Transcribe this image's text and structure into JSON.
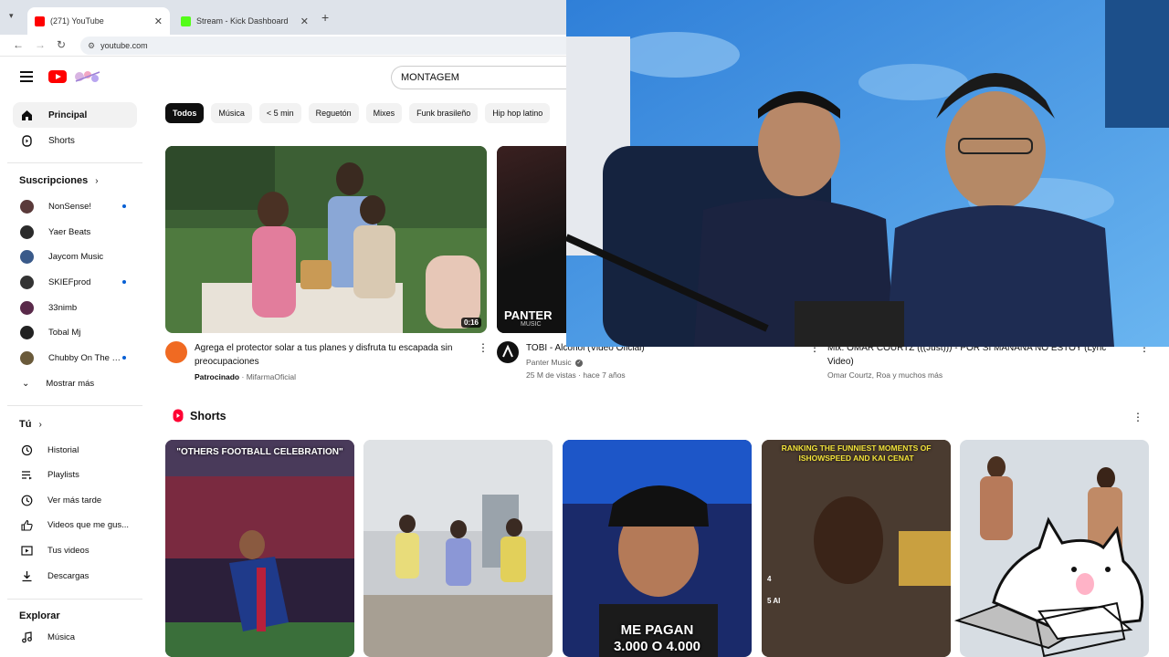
{
  "browser": {
    "tabs": [
      {
        "label": "(271) YouTube",
        "active": true,
        "favicon_color": "#ff0000"
      },
      {
        "label": "Stream - Kick Dashboard",
        "active": false,
        "favicon_color": "#53fc18"
      }
    ],
    "url": "youtube.com"
  },
  "youtube": {
    "search_query": "MONTAGEM",
    "sidebar": {
      "main": [
        {
          "label": "Principal",
          "icon": "home-icon",
          "active": true
        },
        {
          "label": "Shorts",
          "icon": "shorts-icon",
          "active": false
        }
      ],
      "subscriptions_heading": "Suscripciones",
      "subscriptions": [
        {
          "name": "NonSense!",
          "new": true,
          "color": "#5a3a3a"
        },
        {
          "name": "Yaer Beats",
          "new": false,
          "color": "#2b2b2b"
        },
        {
          "name": "Jaycom Music",
          "new": false,
          "color": "#3a5a8a"
        },
        {
          "name": "SKIEFprod",
          "new": true,
          "color": "#333333"
        },
        {
          "name": "33nimb",
          "new": false,
          "color": "#5a2a4a"
        },
        {
          "name": "Tobal Mj",
          "new": false,
          "color": "#222222"
        },
        {
          "name": "Chubby On The B...",
          "new": true,
          "color": "#6a5a3a"
        }
      ],
      "show_more": "Mostrar más",
      "you_heading": "Tú",
      "you_items": [
        {
          "label": "Historial",
          "icon": "history-icon"
        },
        {
          "label": "Playlists",
          "icon": "playlists-icon"
        },
        {
          "label": "Ver más tarde",
          "icon": "watch-later-icon"
        },
        {
          "label": "Videos que me gus...",
          "icon": "like-icon"
        },
        {
          "label": "Tus videos",
          "icon": "your-videos-icon"
        },
        {
          "label": "Descargas",
          "icon": "download-icon"
        }
      ],
      "explore_heading": "Explorar",
      "explore_items": [
        {
          "label": "Música",
          "icon": "music-icon"
        }
      ]
    },
    "chips": [
      "Todos",
      "Música",
      "< 5 min",
      "Reguetón",
      "Mixes",
      "Funk brasileño",
      "Hip hop latino"
    ],
    "videos": [
      {
        "title": "Agrega el protector solar a tus planes y disfruta tu escapada sin preocupaciones",
        "sponsored_label": "Patrocinado",
        "channel": "MifarmaOficial",
        "duration": "0:16"
      },
      {
        "title": "TOBI - Alcohol (Video Oficial)",
        "channel": "Panter Music",
        "stats": "25 M de vistas · hace 7 años",
        "thumb_text": "PANTER",
        "thumb_subtext": "MUSIC"
      },
      {
        "title": "Mix: OMAR COURTZ (((Just))) - POR SI MAÑANA NO ESTOY (Lyric Video)",
        "channel": "Omar Courtz, Roa y muchos más"
      }
    ],
    "shorts_heading": "Shorts",
    "shorts": [
      {
        "top_text": "\"OTHERS FOOTBALL CELEBRATION\"",
        "bottom_text": ""
      },
      {
        "top_text": "",
        "bottom_text": ""
      },
      {
        "top_text": "",
        "bottom_text": "ME PAGAN\n3.000 O 4.000"
      },
      {
        "top_text": "RANKING THE FUNNIEST MOMENTS OF ISHOWSPEED AND KAI CENAT",
        "bottom_text": "",
        "list_labels": [
          "4",
          "5 AI"
        ]
      },
      {
        "top_text": "",
        "bottom_text": ""
      }
    ]
  }
}
